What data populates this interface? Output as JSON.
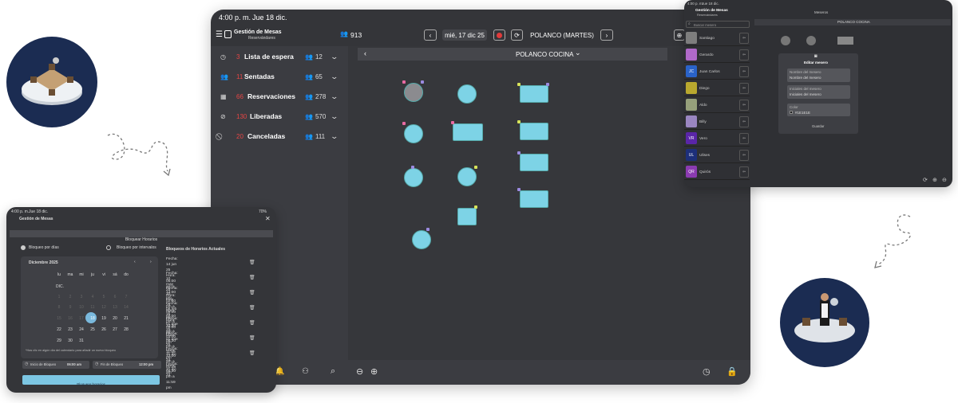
{
  "main": {
    "status_time": "4:00 p. m.",
    "status_date": "Jue 18 dic.",
    "app_title": "Gestión de Mesas",
    "app_subtitle": "Reservándares",
    "guest_count": "913",
    "date_label": "mié, 17 dic 25",
    "location_label": "POLANCO (MARTES)",
    "floor_label": "POLANCO COCINA",
    "sidebar": [
      {
        "num": "3",
        "label": "Lista de espera",
        "count": "12"
      },
      {
        "num": "11",
        "label": "Sentadas",
        "count": "65"
      },
      {
        "num": "66",
        "label": "Reservaciones",
        "count": "278"
      },
      {
        "num": "130",
        "label": "Liberadas",
        "count": "570"
      },
      {
        "num": "20",
        "label": "Canceladas",
        "count": "111"
      }
    ]
  },
  "calendar": {
    "status_time": "4:00 p. m.",
    "status_date": "Jue 18 dic.",
    "battery": "70%",
    "app_title": "Gestión de Mesas",
    "header_button": "Bloquear Horarios",
    "option_days": "Bloqueo por días",
    "option_intervals": "Bloqueo por intervalos",
    "month": "Diciembre 2025",
    "weekdays": [
      "lu",
      "ma",
      "mi",
      "ju",
      "vi",
      "sá",
      "do"
    ],
    "month_abbr": "DIC.",
    "week_rows": [
      [
        "1",
        "2",
        "3",
        "4",
        "5",
        "6",
        "7"
      ],
      [
        "8",
        "9",
        "10",
        "11",
        "12",
        "13",
        "14"
      ],
      [
        "15",
        "16",
        "17",
        "18",
        "19",
        "20",
        "21"
      ],
      [
        "22",
        "23",
        "24",
        "25",
        "26",
        "27",
        "28"
      ],
      [
        "29",
        "30",
        "31",
        "",
        "",
        "",
        ""
      ]
    ],
    "selected_day": "18",
    "note": "*Has clic en algún día del calendario para añadir un nuevo bloqueo",
    "start_label": "Inicio de Bloqueo",
    "start_value": "06:00 am",
    "end_label": "Fin de Bloqueo",
    "end_value": "12:00 pm",
    "submit": "Bloquear horarios",
    "blocks_title": "Bloqueos de Horarios Actuales",
    "blocks": [
      {
        "date": "Fecha: 14 jun 25",
        "time": "Hora: 06:00 am a 12:00 pm"
      },
      {
        "date": "Fecha: 10 may 25",
        "time": "Hora: 02:00 pm a 09:00 pm"
      },
      {
        "date": "Fecha: 10 may 25",
        "time": "Hora: 02:00 pm a 09:00 pm"
      },
      {
        "date": "Fecha: 08 feb 25",
        "time": "Hora: 10:30 am a 03:00 pm"
      },
      {
        "date": "Fecha: 01 ene 25",
        "time": "Hora: 06:30 pm a 11:59 pm"
      },
      {
        "date": "Fecha: 01 ene 25",
        "time": "Hora: 12:00 am a 01:28 am"
      },
      {
        "date": "Fecha: 31 dic 24",
        "time": "Hora: 04:30 pm a 11:59 pm"
      },
      {
        "date": "Fecha: 31 dic 24",
        "time": ""
      }
    ]
  },
  "waiters": {
    "status_time": "4:00 p. m.",
    "status_date": "Jue 18 dic.",
    "app_title": "Gestión de Mesas",
    "app_subtitle": "Reservándares",
    "tab": "Meseros",
    "search_placeholder": "Buscar mesero",
    "floor_label": "POLANCO COCINA",
    "list": [
      {
        "initials": "",
        "name": "Santiago",
        "color": "#7e7e7e"
      },
      {
        "initials": "",
        "name": "Gerardo",
        "color": "#b069c9"
      },
      {
        "initials": "JC",
        "name": "Juan Carlos",
        "color": "#2a63c9"
      },
      {
        "initials": "",
        "name": "Diego",
        "color": "#b9a82e"
      },
      {
        "initials": "",
        "name": "Aldo",
        "color": "#96a07b"
      },
      {
        "initials": "",
        "name": "Billy",
        "color": "#9a86c1"
      },
      {
        "initials": "VR",
        "name": "Vero",
        "color": "#5a25a8"
      },
      {
        "initials": "UL",
        "name": "Ulises",
        "color": "#1d2f7a"
      },
      {
        "initials": "QR",
        "name": "Quirós",
        "color": "#8b3bb1"
      }
    ],
    "edit_title": "Editar mesero",
    "field_name_label": "Nombre del mesero",
    "field_name_value": "Nombre del mesero",
    "field_initials_label": "Iniciales del mesero",
    "field_initials_value": "Iniciales del mesero",
    "field_color_label": "Color",
    "field_color_value": "#1E1E1E",
    "save": "Guardar"
  }
}
